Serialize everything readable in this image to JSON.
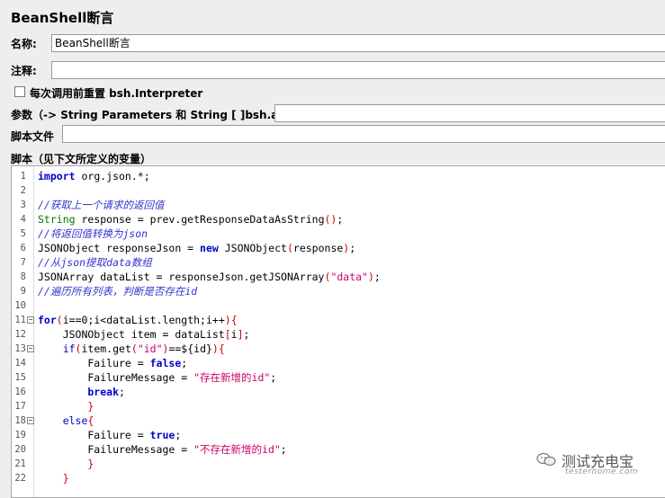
{
  "header": {
    "title": "BeanShell断言"
  },
  "form": {
    "name_label": "名称:",
    "name_value": "BeanShell断言",
    "comment_label": "注释:",
    "comment_value": "",
    "reset_checkbox_label": "每次调用前重置 bsh.Interpreter",
    "params_label": "参数（-> String Parameters 和 String [ ]bsh.args)",
    "params_value": "",
    "script_file_label": "脚本文件",
    "script_file_value": "",
    "script_label": "脚本（见下文所定义的变量）"
  },
  "code": {
    "line_numbers": [
      "1",
      "2",
      "3",
      "4",
      "5",
      "6",
      "7",
      "8",
      "9",
      "10",
      "11",
      "12",
      "13",
      "14",
      "15",
      "16",
      "17",
      "18",
      "19",
      "20",
      "21",
      "22"
    ],
    "fold_markers_lines": [
      11,
      13,
      18
    ],
    "lines": [
      [
        [
          "kw",
          "import"
        ],
        [
          "tx",
          " org.json.*;"
        ]
      ],
      [],
      [
        [
          "cm",
          "//获取上一个请求的返回值"
        ]
      ],
      [
        [
          "ty",
          "String"
        ],
        [
          "tx",
          " response = prev.getResponseDataAsString"
        ],
        [
          "rb",
          "()"
        ],
        [
          "tx",
          ";"
        ]
      ],
      [
        [
          "cm",
          "//将返回值转换为json"
        ]
      ],
      [
        [
          "tx",
          "JSONObject responseJson = "
        ],
        [
          "kw",
          "new"
        ],
        [
          "tx",
          " JSONObject"
        ],
        [
          "rb",
          "("
        ],
        [
          "tx",
          "response"
        ],
        [
          "rb",
          ")"
        ],
        [
          "tx",
          ";"
        ]
      ],
      [
        [
          "cm",
          "//从json提取data数组"
        ]
      ],
      [
        [
          "tx",
          "JSONArray dataList = responseJson.getJSONArray"
        ],
        [
          "rb",
          "("
        ],
        [
          "st",
          "\"data\""
        ],
        [
          "rb",
          ")"
        ],
        [
          "tx",
          ";"
        ]
      ],
      [
        [
          "cm",
          "//遍历所有列表，判断是否存在id"
        ]
      ],
      [],
      [
        [
          "kw",
          "for"
        ],
        [
          "rb",
          "("
        ],
        [
          "tx",
          "i=="
        ],
        [
          "tx",
          "0"
        ],
        [
          "tx",
          ";i<dataList.length;i++"
        ],
        [
          "rb",
          ")"
        ],
        [
          "rb",
          "{"
        ]
      ],
      [
        [
          "tx",
          "    JSONObject item = dataList"
        ],
        [
          "rb",
          "["
        ],
        [
          "tx",
          "i"
        ],
        [
          "rb",
          "]"
        ],
        [
          "tx",
          ";"
        ]
      ],
      [
        [
          "kw2",
          "    if"
        ],
        [
          "rb",
          "("
        ],
        [
          "tx",
          "item.get"
        ],
        [
          "rb",
          "("
        ],
        [
          "st",
          "\"id\""
        ],
        [
          "rb",
          ")"
        ],
        [
          "tx",
          "==${id}"
        ],
        [
          "rb",
          ")"
        ],
        [
          "rb",
          "{"
        ]
      ],
      [
        [
          "tx",
          "        Failure = "
        ],
        [
          "kw",
          "false"
        ],
        [
          "tx",
          ";"
        ]
      ],
      [
        [
          "tx",
          "        FailureMessage = "
        ],
        [
          "st",
          "\"存在新增的id\""
        ],
        [
          "tx",
          ";"
        ]
      ],
      [
        [
          "kw",
          "        break"
        ],
        [
          "tx",
          ";"
        ]
      ],
      [
        [
          "rb",
          "        }"
        ]
      ],
      [
        [
          "kw2",
          "    else"
        ],
        [
          "rb",
          "{"
        ]
      ],
      [
        [
          "tx",
          "        Failure = "
        ],
        [
          "kw",
          "true"
        ],
        [
          "tx",
          ";"
        ]
      ],
      [
        [
          "tx",
          "        FailureMessage = "
        ],
        [
          "st",
          "\"不存在新增的id\""
        ],
        [
          "tx",
          ";"
        ]
      ],
      [
        [
          "rb",
          "        }"
        ]
      ],
      [
        [
          "rb",
          "    }"
        ]
      ]
    ]
  },
  "watermark": {
    "text": "测试充电宝",
    "subtext": "testerhome.com",
    "icon": "wechat-icon"
  }
}
